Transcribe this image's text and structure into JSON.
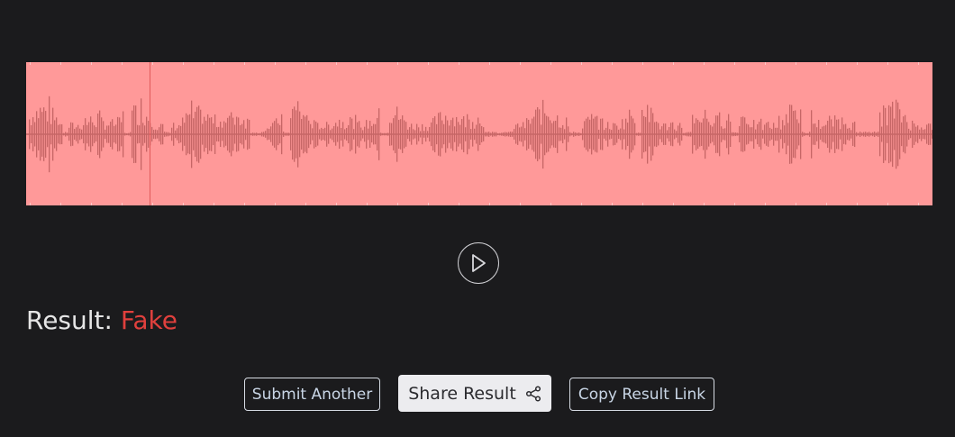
{
  "player": {
    "waveform_color": "#c66666",
    "background_color": "#ff9999",
    "play_icon": "play-icon"
  },
  "result": {
    "label": "Result:",
    "verdict": "Fake",
    "verdict_color": "#e0403d"
  },
  "actions": {
    "submit_another": "Submit Another",
    "share_result": "Share Result",
    "share_icon": "share-icon",
    "copy_result_link": "Copy Result Link"
  }
}
